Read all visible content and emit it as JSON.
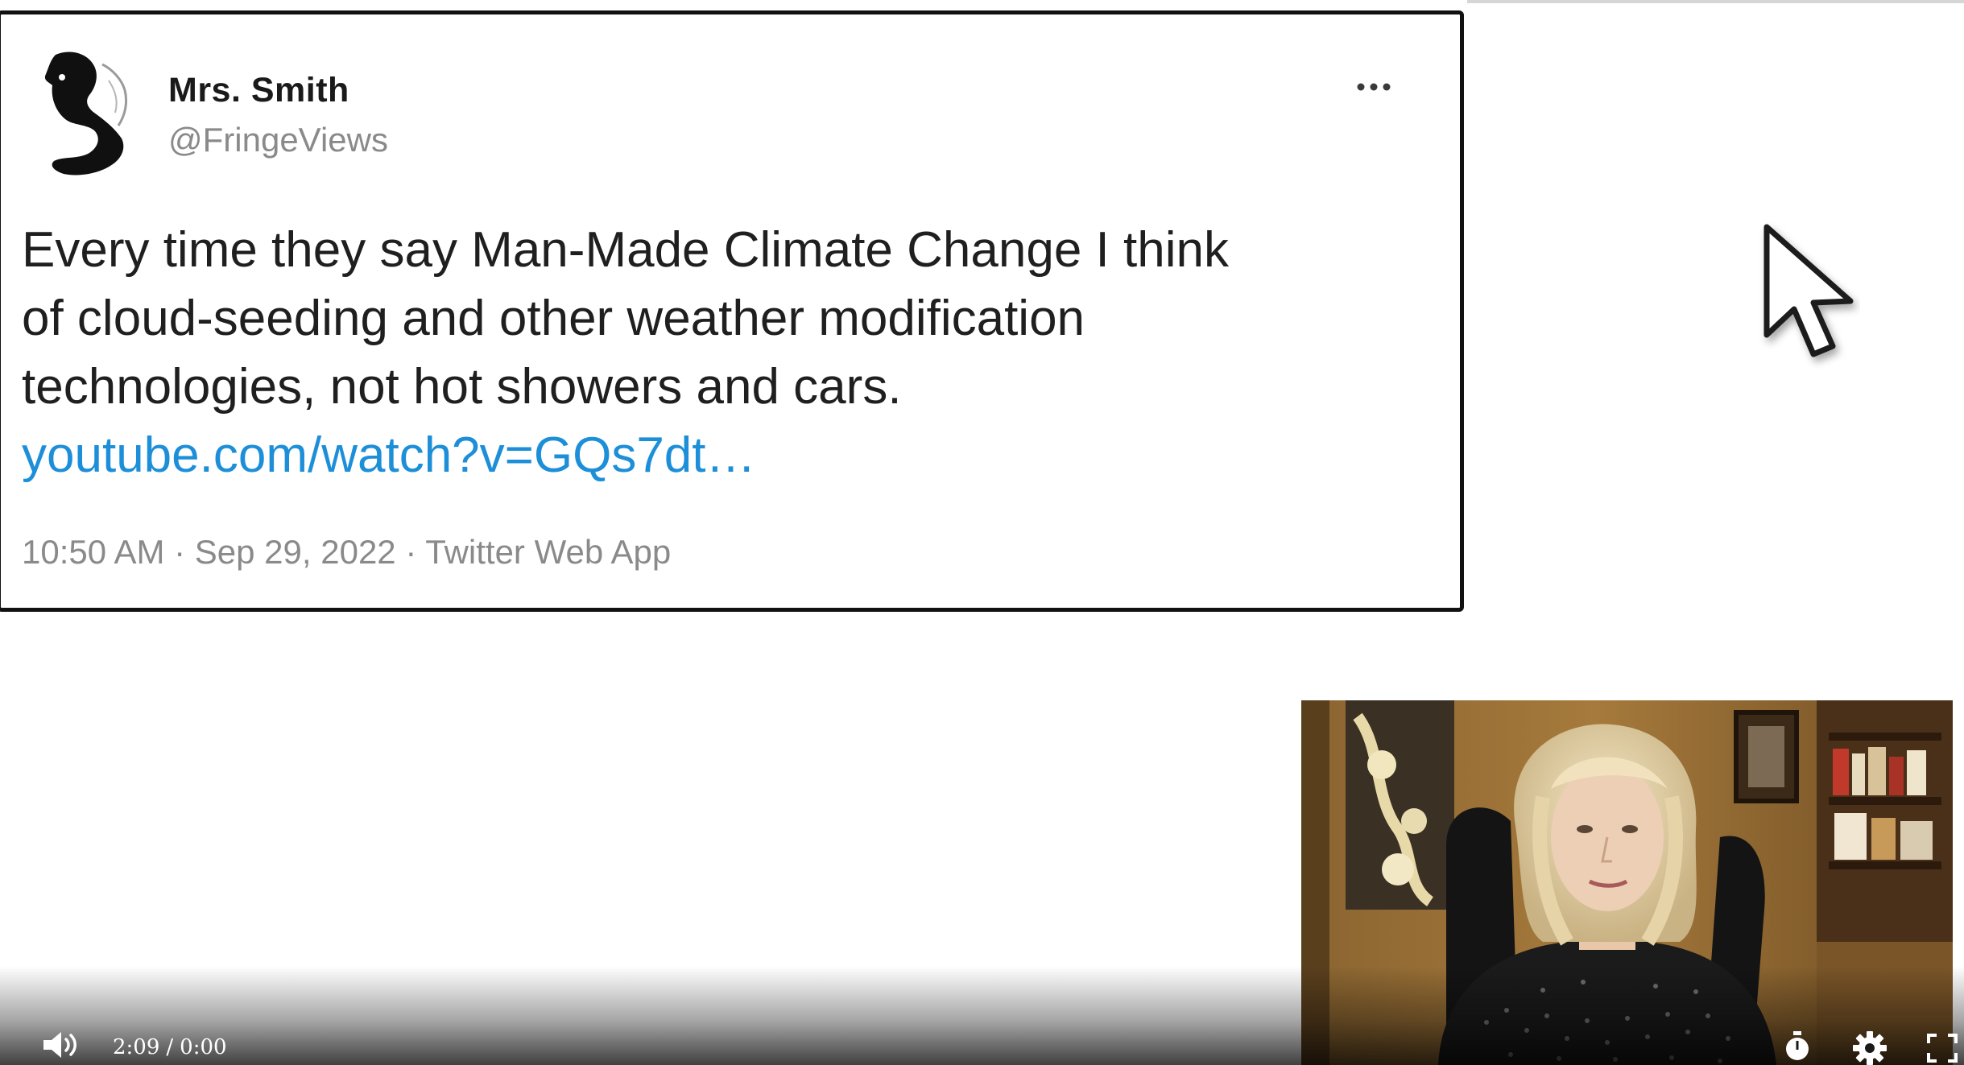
{
  "tweet": {
    "display_name": "Mrs. Smith",
    "handle": "@FringeViews",
    "text_lines": [
      "Every time they say Man-Made Climate Change I think",
      "of cloud-seeding and other weather modification",
      "technologies, not hot showers and cars."
    ],
    "link_text": "youtube.com/watch?v=GQs7dt…",
    "meta": "10:50 AM · Sep 29, 2022 · Twitter Web App",
    "more_icon": "more-horizontal-icon",
    "avatar_icon": "avatar-silhouette-icon"
  },
  "player": {
    "current_time": "2:09",
    "separator": "/",
    "duration": "0:00",
    "icons": [
      "volume-icon",
      "timer-icon",
      "settings-icon",
      "fullscreen-icon"
    ]
  },
  "colors": {
    "link": "#1d8fd9",
    "text": "#1f1f1f",
    "muted": "#8a8a8a",
    "card_border": "#111111"
  }
}
